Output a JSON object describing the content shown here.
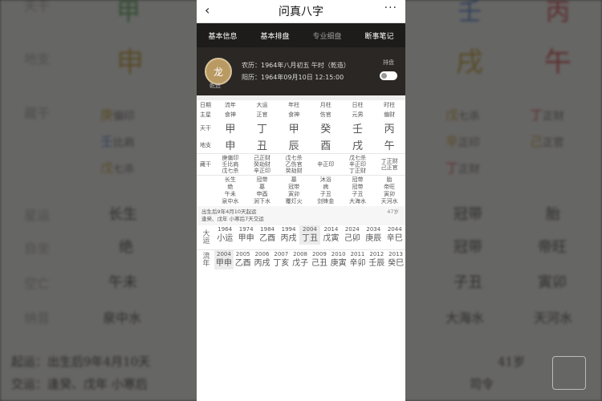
{
  "phone": {
    "title": "问真八字",
    "back_icon": "‹",
    "more_icon": "···",
    "tabs": [
      "基本信息",
      "基本排盘",
      "专业细盘",
      "断事笔记"
    ],
    "avatar_char": "龙",
    "avatar_label": "乾造",
    "lunar": "农历：1964年八月初五 午时（乾造）",
    "solar": "阳历：1964年09月10日 12:15:00",
    "toggle_label": "排盘",
    "pillar_headers": [
      "日期",
      "流年",
      "大运",
      "年柱",
      "月柱",
      "日柱",
      "时柱"
    ],
    "shishen": [
      "",
      "食神",
      "正官",
      "食神",
      "伤官",
      "元男",
      "偏财"
    ],
    "gan": [
      "甲",
      "丁",
      "甲",
      "癸",
      "壬",
      "丙"
    ],
    "zhi": [
      "申",
      "丑",
      "辰",
      "酉",
      "戌",
      "午"
    ],
    "row_labels": {
      "shishen": "主星",
      "gan": "天干",
      "zhi": "地支",
      "hidden": "藏干"
    },
    "hidden": [
      [
        "庚偏印",
        "壬比肩",
        "戊七杀"
      ],
      [
        "己正财",
        "癸劫财",
        "辛正印"
      ],
      [
        "戊七杀",
        "乙伤官",
        "癸劫财"
      ],
      [
        "辛正印"
      ],
      [
        "戊七杀",
        "辛正印",
        "丁正财"
      ],
      [
        "丁正财",
        "己正官"
      ]
    ],
    "stages": [
      [
        "长生",
        "绝",
        "午未",
        "泉中水"
      ],
      [
        "冠带",
        "墓",
        "申酉",
        "涧下水"
      ],
      [
        "墓",
        "冠带",
        "寅卯",
        "覆灯火"
      ],
      [
        "沐浴",
        "病",
        "子丑",
        "剑锋金"
      ],
      [
        "冠带",
        "冠带",
        "子丑",
        "大海水"
      ],
      [
        "胎",
        "帝旺",
        "寅卯",
        "天河水"
      ]
    ],
    "qiyun": "出生后9年4月10天起运",
    "jiaoyun": "逢癸、戊年 小寒后7天交运",
    "age": "47岁",
    "dayun_label": "大运",
    "dayun": [
      {
        "year": "1964",
        "gz": "小运",
        "sub": ""
      },
      {
        "year": "1974",
        "gz": "甲申",
        "sub": ""
      },
      {
        "year": "1984",
        "gz": "乙酉",
        "sub": ""
      },
      {
        "year": "1994",
        "gz": "丙戌",
        "sub": ""
      },
      {
        "year": "2004",
        "gz": "丁丑",
        "sub": ""
      },
      {
        "year": "2014",
        "gz": "戊寅",
        "sub": ""
      },
      {
        "year": "2024",
        "gz": "己卯",
        "sub": ""
      },
      {
        "year": "2034",
        "gz": "庚辰",
        "sub": ""
      },
      {
        "year": "2044",
        "gz": "辛巳",
        "sub": ""
      }
    ],
    "liunian_label": "流年",
    "liunian": [
      {
        "year": "2004",
        "gz": "甲申"
      },
      {
        "year": "2005",
        "gz": "乙酉"
      },
      {
        "year": "2006",
        "gz": "丙戌"
      },
      {
        "year": "2007",
        "gz": "丁亥"
      },
      {
        "year": "2008",
        "gz": "戊子"
      },
      {
        "year": "2009",
        "gz": "己丑"
      },
      {
        "year": "2010",
        "gz": "庚寅"
      },
      {
        "year": "2011",
        "gz": "辛卯"
      },
      {
        "year": "2012",
        "gz": "壬辰"
      },
      {
        "year": "2013",
        "gz": "癸巳"
      }
    ]
  },
  "background": {
    "rows": [
      "天干",
      "地支",
      "藏干",
      "星运",
      "自坐",
      "空亡",
      "纳音"
    ],
    "bottom_left": [
      "起运：出生后9年4月10天",
      "交运：逢癸、戊年 小寒后"
    ],
    "bottom_right": [
      "41岁",
      "司令"
    ]
  },
  "colors": {
    "green": "#3a9a3a",
    "red": "#c33",
    "gold": "#b8901a",
    "blue": "#3b6fc9"
  }
}
